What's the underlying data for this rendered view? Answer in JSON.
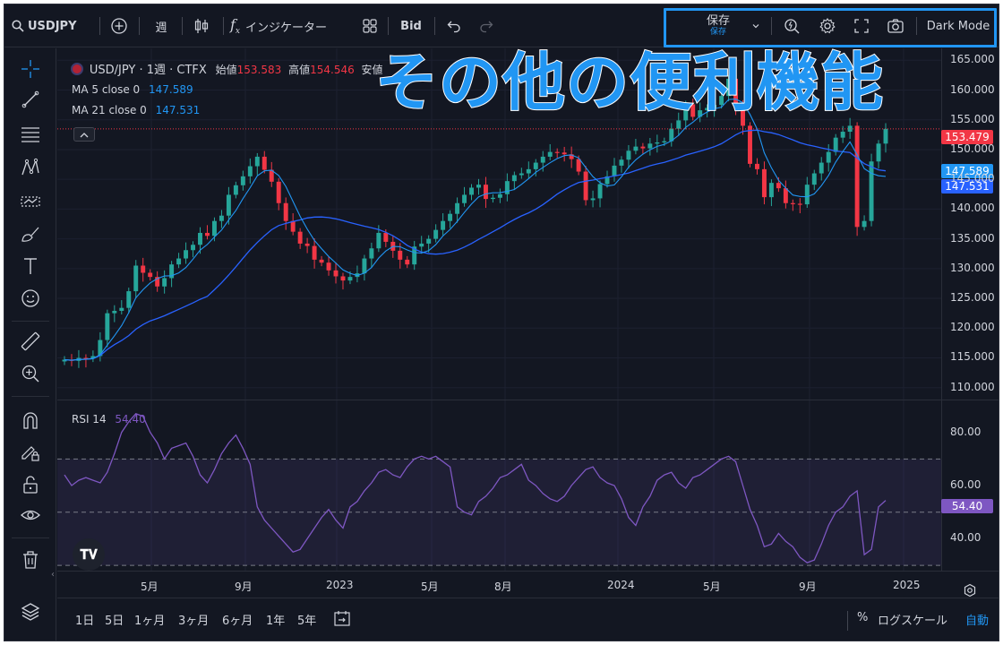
{
  "toolbar": {
    "symbol": "USDJPY",
    "interval": "週",
    "indicators": "インジケーター",
    "price_type": "Bid",
    "save_label": "保存",
    "save_sub": "保存",
    "dark_mode": "Dark Mode"
  },
  "legend": {
    "pair": "USD/JPY · 1週 · CTFX",
    "open_label": "始値",
    "open_value": "153.583",
    "high_label": "高値",
    "high_value": "154.546",
    "low_label": "安値",
    "ma5_label": "MA 5 close 0",
    "ma5_value": "147.589",
    "ma21_label": "MA 21 close 0",
    "ma21_value": "147.531",
    "rsi_label": "RSI 14",
    "rsi_value": "54.40"
  },
  "overlay_title": "その他の便利機能",
  "price_axis": [
    "165.000",
    "160.000",
    "155.000",
    "150.000",
    "145.000",
    "140.000",
    "135.000",
    "130.000",
    "125.000",
    "120.000",
    "115.000",
    "110.000"
  ],
  "price_tags": {
    "last": "153.479",
    "ma5": "147.589",
    "ma21": "147.531",
    "rsi": "54.40"
  },
  "rsi_axis": [
    "80.00",
    "60.00",
    "40.00"
  ],
  "time_axis": [
    "5月",
    "9月",
    "2023",
    "5月",
    "8月",
    "2024",
    "5月",
    "9月",
    "2025"
  ],
  "bottom_bar": {
    "ranges": [
      "1日",
      "5日",
      "1ヶ月",
      "3ヶ月",
      "6ヶ月",
      "1年",
      "5年"
    ],
    "percent": "%",
    "log": "ログスケール",
    "auto": "自動"
  },
  "colors": {
    "up": "#26a69a",
    "down": "#f23645",
    "ma5": "#2196f3",
    "ma21": "#2962ff",
    "rsi": "#7e57c2",
    "accent": "#2196f3"
  },
  "chart_data": {
    "type": "candlestick",
    "title": "USD/JPY · 1週 · CTFX",
    "ylim": [
      108,
      167
    ],
    "x_ticks": [
      "5月",
      "9月",
      "2023",
      "5月",
      "8月",
      "2024",
      "5月",
      "9月",
      "2025"
    ],
    "close_path": [
      114.7,
      114.5,
      115,
      114.9,
      115.3,
      118,
      122.5,
      122.9,
      123.4,
      126.2,
      130.5,
      129.3,
      128.6,
      127,
      128.4,
      130.7,
      131.7,
      133.1,
      134,
      136,
      135.5,
      138,
      138.9,
      142.4,
      144,
      145.5,
      147.2,
      148.8,
      146.6,
      144.6,
      141,
      138,
      136.2,
      134.2,
      133.8,
      131.5,
      131,
      129.7,
      128.7,
      128,
      128.6,
      129.2,
      131.7,
      133.4,
      136,
      134.5,
      133,
      131.5,
      130.7,
      133.7,
      134.2,
      135,
      136.5,
      138,
      139.2,
      141,
      142.4,
      143.6,
      144.1,
      141.7,
      141.9,
      142.5,
      144.7,
      145.7,
      146,
      146.7,
      147.8,
      148.8,
      149.6,
      149.5,
      149.2,
      148.4,
      146.3,
      141.5,
      141.8,
      144.2,
      145.5,
      147.3,
      148.3,
      149.8,
      150.5,
      150.2,
      151,
      151.2,
      151.4,
      153.5,
      154.9,
      157.6,
      155.5,
      156.6,
      157,
      157.5,
      159,
      161.9,
      157,
      154,
      147.6,
      146.7,
      142,
      144.4,
      143.5,
      141,
      140.9,
      140.8,
      144.1,
      146,
      147.8,
      149.6,
      152,
      153,
      154,
      137,
      138,
      148,
      151,
      153.48
    ],
    "ma5_last": 147.589,
    "ma21_last": 147.531,
    "last_price": 153.479
  },
  "rsi_chart": {
    "type": "line",
    "ylim": [
      28,
      92
    ],
    "levels": [
      70,
      50,
      30
    ],
    "values": [
      64,
      60,
      62,
      63,
      62,
      61,
      65,
      72,
      80,
      84,
      87,
      86,
      80,
      76,
      70,
      74,
      75,
      76,
      71,
      64,
      61,
      66,
      72,
      76,
      79,
      74,
      68,
      52,
      47,
      44,
      41,
      38,
      35,
      36,
      40,
      44,
      48,
      51,
      47,
      44,
      52,
      54,
      58,
      61,
      65,
      66,
      64,
      63,
      67,
      70,
      71,
      70,
      71,
      69,
      67,
      52,
      50,
      49,
      54,
      56,
      59,
      63,
      64,
      66,
      68,
      62,
      60,
      57,
      55,
      54,
      56,
      60,
      63,
      66,
      67,
      63,
      61,
      60,
      55,
      48,
      45,
      52,
      56,
      62,
      64,
      65,
      61,
      59,
      63,
      64,
      66,
      68,
      70,
      71,
      69,
      60,
      51,
      45,
      37,
      38,
      42,
      39,
      37,
      33,
      31,
      32,
      38,
      45,
      50,
      52,
      56,
      58,
      34,
      36,
      52,
      54.4
    ]
  }
}
